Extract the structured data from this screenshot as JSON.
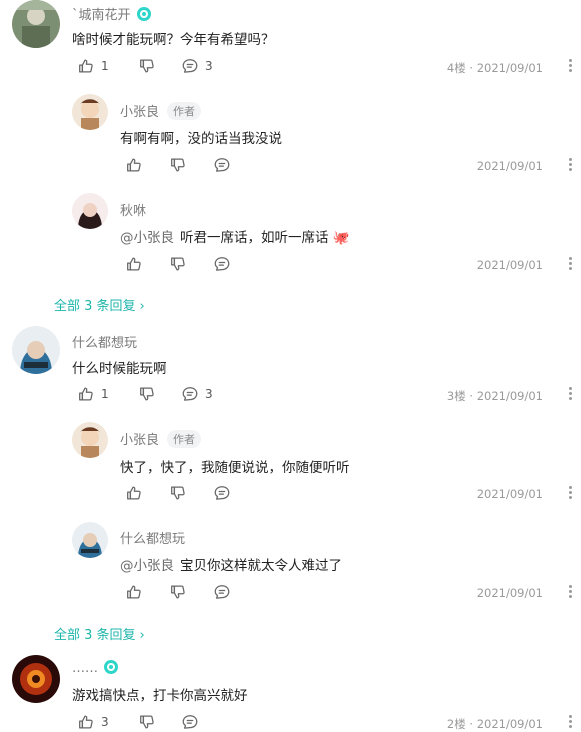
{
  "colors": {
    "accent": "#1fb5ab",
    "muted": "#9a9a9a"
  },
  "comments": [
    {
      "user": "`城南花开",
      "verified": true,
      "text": "啥时候才能玩啊？今年有希望吗？",
      "likes": "1",
      "replies_count": "3",
      "floor_date": "4楼 · 2021/09/01",
      "replies": [
        {
          "user": "小张良",
          "badge": "作者",
          "mention": "",
          "text": "有啊有啊，没的话当我没说",
          "date": "2021/09/01"
        },
        {
          "user": "秋咻",
          "badge": "",
          "mention": "@小张良",
          "text": "听君一席话，如听一席话",
          "emoji": "🐙",
          "date": "2021/09/01"
        }
      ],
      "all_replies_label": "全部 3 条回复"
    },
    {
      "user": "什么都想玩",
      "verified": false,
      "text": "什么时候能玩啊",
      "likes": "1",
      "replies_count": "3",
      "floor_date": "3楼 · 2021/09/01",
      "replies": [
        {
          "user": "小张良",
          "badge": "作者",
          "mention": "",
          "text": "快了，快了，我随便说说，你随便听听",
          "date": "2021/09/01"
        },
        {
          "user": "什么都想玩",
          "badge": "",
          "mention": "@小张良",
          "text": "宝贝你这样就太令人难过了",
          "date": "2021/09/01"
        }
      ],
      "all_replies_label": "全部 3 条回复"
    },
    {
      "user": "……",
      "verified": true,
      "text": "游戏搞快点，打卡你高兴就好",
      "likes": "3",
      "replies_count": "",
      "floor_date": "2楼 · 2021/09/01"
    }
  ],
  "icons": {
    "like": "thumb-up-icon",
    "dislike": "thumb-down-icon",
    "reply": "comment-bubble-icon",
    "more": "more-dots-icon",
    "chevron": "chevron-right-icon"
  }
}
